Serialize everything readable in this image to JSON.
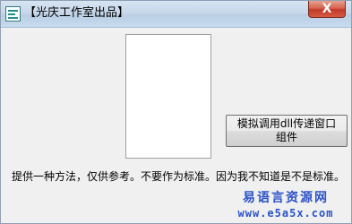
{
  "window": {
    "title": "【光庆工作室出品】",
    "close_glyph": "X"
  },
  "main": {
    "action_button_label": "模拟调用dll传递窗口组件",
    "info_text": "提供一种方法，仅供参考。不要作为标准。因为我不知道是不是标准。"
  },
  "watermark": {
    "line1": "易语言资源网",
    "line2": "www.e5a5x.com"
  },
  "colors": {
    "watermark": "#2c53c8",
    "close_button": "#c0392b"
  }
}
